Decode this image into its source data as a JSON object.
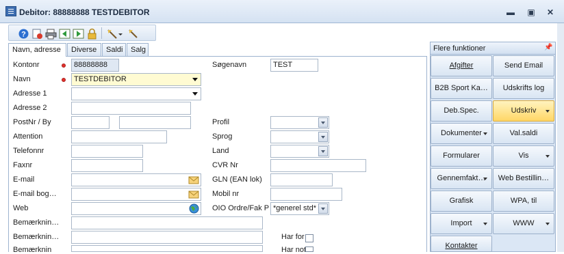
{
  "window": {
    "title": "Debitor: 88888888 TESTDEBITOR"
  },
  "tabs": [
    "Navn, adresse",
    "Diverse",
    "Saldi",
    "Salg"
  ],
  "form": {
    "left": [
      {
        "label": "Kontonr",
        "value": "88888888",
        "required": true
      },
      {
        "label": "Navn",
        "value": "TESTDEBITOR",
        "required": true
      },
      {
        "label": "Adresse 1",
        "value": ""
      },
      {
        "label": "Adresse 2",
        "value": ""
      },
      {
        "label": "PostNr / By",
        "value": ""
      },
      {
        "label": "Attention",
        "value": ""
      },
      {
        "label": "Telefonnr",
        "value": ""
      },
      {
        "label": "Faxnr",
        "value": ""
      },
      {
        "label": "E-mail",
        "value": ""
      },
      {
        "label": "E-mail bog…",
        "value": ""
      },
      {
        "label": "Web",
        "value": ""
      },
      {
        "label": "Bemærknin…",
        "value": ""
      },
      {
        "label": "Bemærknin…",
        "value": ""
      },
      {
        "label": "Bemærknin",
        "value": ""
      }
    ],
    "right": [
      {
        "label": "Søgenavn",
        "value": "TEST"
      },
      {
        "label": "Profil",
        "value": ""
      },
      {
        "label": "Sprog",
        "value": ""
      },
      {
        "label": "Land",
        "value": ""
      },
      {
        "label": "CVR Nr",
        "value": ""
      },
      {
        "label": "GLN (EAN lok)",
        "value": ""
      },
      {
        "label": "Mobil nr",
        "value": ""
      },
      {
        "label": "OIO Ordre/Fak P",
        "value": "*generel std*"
      }
    ],
    "checks": [
      {
        "label": "Har for"
      },
      {
        "label": "Har not"
      }
    ]
  },
  "side_panel": {
    "title": "Flere funktioner",
    "pin_icon": "pin-icon",
    "buttons": [
      {
        "label": "Afgifter",
        "dropdown": false,
        "highlight": false
      },
      {
        "label": "Send Email",
        "dropdown": false,
        "highlight": false
      },
      {
        "label": "B2B Sport Ka…",
        "dropdown": false,
        "highlight": false
      },
      {
        "label": "Udskrifts log",
        "dropdown": false,
        "highlight": false
      },
      {
        "label": "Deb.Spec.",
        "dropdown": false,
        "highlight": false
      },
      {
        "label": "Udskriv",
        "dropdown": true,
        "highlight": true
      },
      {
        "label": "Dokumenter",
        "dropdown": true,
        "highlight": false
      },
      {
        "label": "Val.saldi",
        "dropdown": false,
        "highlight": false
      },
      {
        "label": "Formularer",
        "dropdown": false,
        "highlight": false
      },
      {
        "label": "Vis",
        "dropdown": true,
        "highlight": false
      },
      {
        "label": "Gennemfakt…",
        "dropdown": true,
        "highlight": false
      },
      {
        "label": "Web Bestillin…",
        "dropdown": false,
        "highlight": false
      },
      {
        "label": "Grafisk",
        "dropdown": false,
        "highlight": false
      },
      {
        "label": "WPA, til",
        "dropdown": false,
        "highlight": false
      },
      {
        "label": "Import",
        "dropdown": true,
        "highlight": false
      },
      {
        "label": "WWW",
        "dropdown": true,
        "highlight": false
      },
      {
        "label": "Kontakter",
        "dropdown": false,
        "highlight": false
      }
    ]
  },
  "colors": {
    "accent": "#3d6db0",
    "highlight": "#ffd766",
    "panel": "#dbe7f5",
    "required": "#e2312d"
  }
}
